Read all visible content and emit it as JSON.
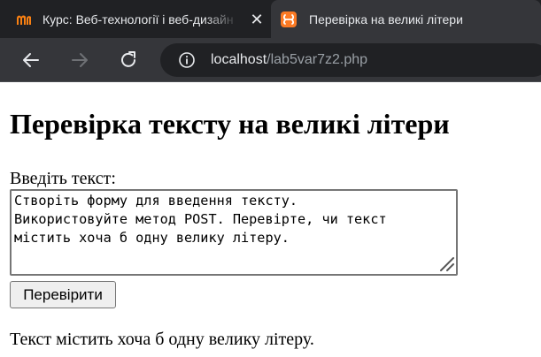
{
  "browser": {
    "tabs": [
      {
        "title": "Курс: Веб-технології і веб-дизайн",
        "close": "✕",
        "active": false,
        "favicon": "moodle-icon"
      },
      {
        "title": "Перевірка на великі літери",
        "close": "✕",
        "active": true,
        "favicon": "xampp-icon"
      }
    ],
    "address": {
      "host": "localhost",
      "path": "/lab5var7z2.php"
    },
    "nav_icons": [
      "back-arrow-icon",
      "forward-arrow-icon",
      "reload-icon",
      "info-icon"
    ],
    "colors": {
      "tabbar": "#202124",
      "toolbar": "#35363a",
      "xampp": "#fb7a24"
    }
  },
  "page": {
    "heading": "Перевірка тексту на великі літери",
    "form": {
      "label": "Введіть текст:",
      "textarea_value": "Створіть форму для введення тексту.\nВикористовуйте метод POST. Перевірте, чи текст\nмістить хоча б одну велику літеру.",
      "submit_label": "Перевірити"
    },
    "result": "Текст містить хоча б одну велику літеру."
  }
}
